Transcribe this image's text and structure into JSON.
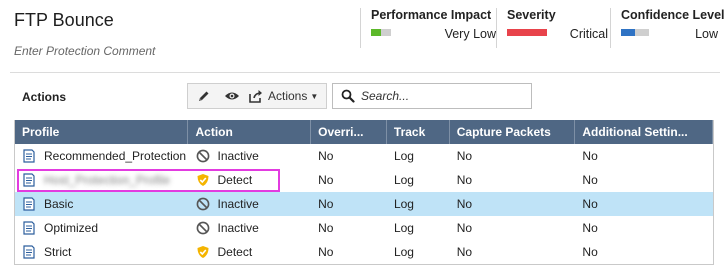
{
  "header": {
    "title": "FTP Bounce",
    "comment_placeholder": "Enter Protection Comment"
  },
  "metrics": [
    {
      "label": "Performance Impact",
      "value": "Very Low",
      "color": "#5cb82a",
      "level": 0.25
    },
    {
      "label": "Severity",
      "value": "Critical",
      "color": "#e8434b",
      "level": 1.0
    },
    {
      "label": "Confidence Level",
      "value": "Low",
      "color": "#2f73c4",
      "level": 0.35
    }
  ],
  "toolbar": {
    "actions_label": "Actions",
    "edit_icon": "pencil-icon",
    "view_icon": "eye-icon",
    "actions_button_label": "Actions",
    "search_placeholder": "Search..."
  },
  "table": {
    "columns": [
      "Profile",
      "Action",
      "Overri...",
      "Track",
      "Capture Packets",
      "Additional Settin..."
    ],
    "rows": [
      {
        "profile": "Recommended_Protection",
        "action": "Inactive",
        "action_icon": "inactive-circle-icon",
        "override": "No",
        "track": "Log",
        "capture": "No",
        "additional": "No",
        "selected": false,
        "highlighted": false
      },
      {
        "profile": "Host_Protection_Profile",
        "action": "Detect",
        "action_icon": "detect-shield-icon",
        "override": "No",
        "track": "Log",
        "capture": "No",
        "additional": "No",
        "selected": false,
        "highlighted": true
      },
      {
        "profile": "Basic",
        "action": "Inactive",
        "action_icon": "inactive-circle-icon",
        "override": "No",
        "track": "Log",
        "capture": "No",
        "additional": "No",
        "selected": true,
        "highlighted": false
      },
      {
        "profile": "Optimized",
        "action": "Inactive",
        "action_icon": "inactive-circle-icon",
        "override": "No",
        "track": "Log",
        "capture": "No",
        "additional": "No",
        "selected": false,
        "highlighted": false
      },
      {
        "profile": "Strict",
        "action": "Detect",
        "action_icon": "detect-shield-icon",
        "override": "No",
        "track": "Log",
        "capture": "No",
        "additional": "No",
        "selected": false,
        "highlighted": false
      }
    ]
  }
}
